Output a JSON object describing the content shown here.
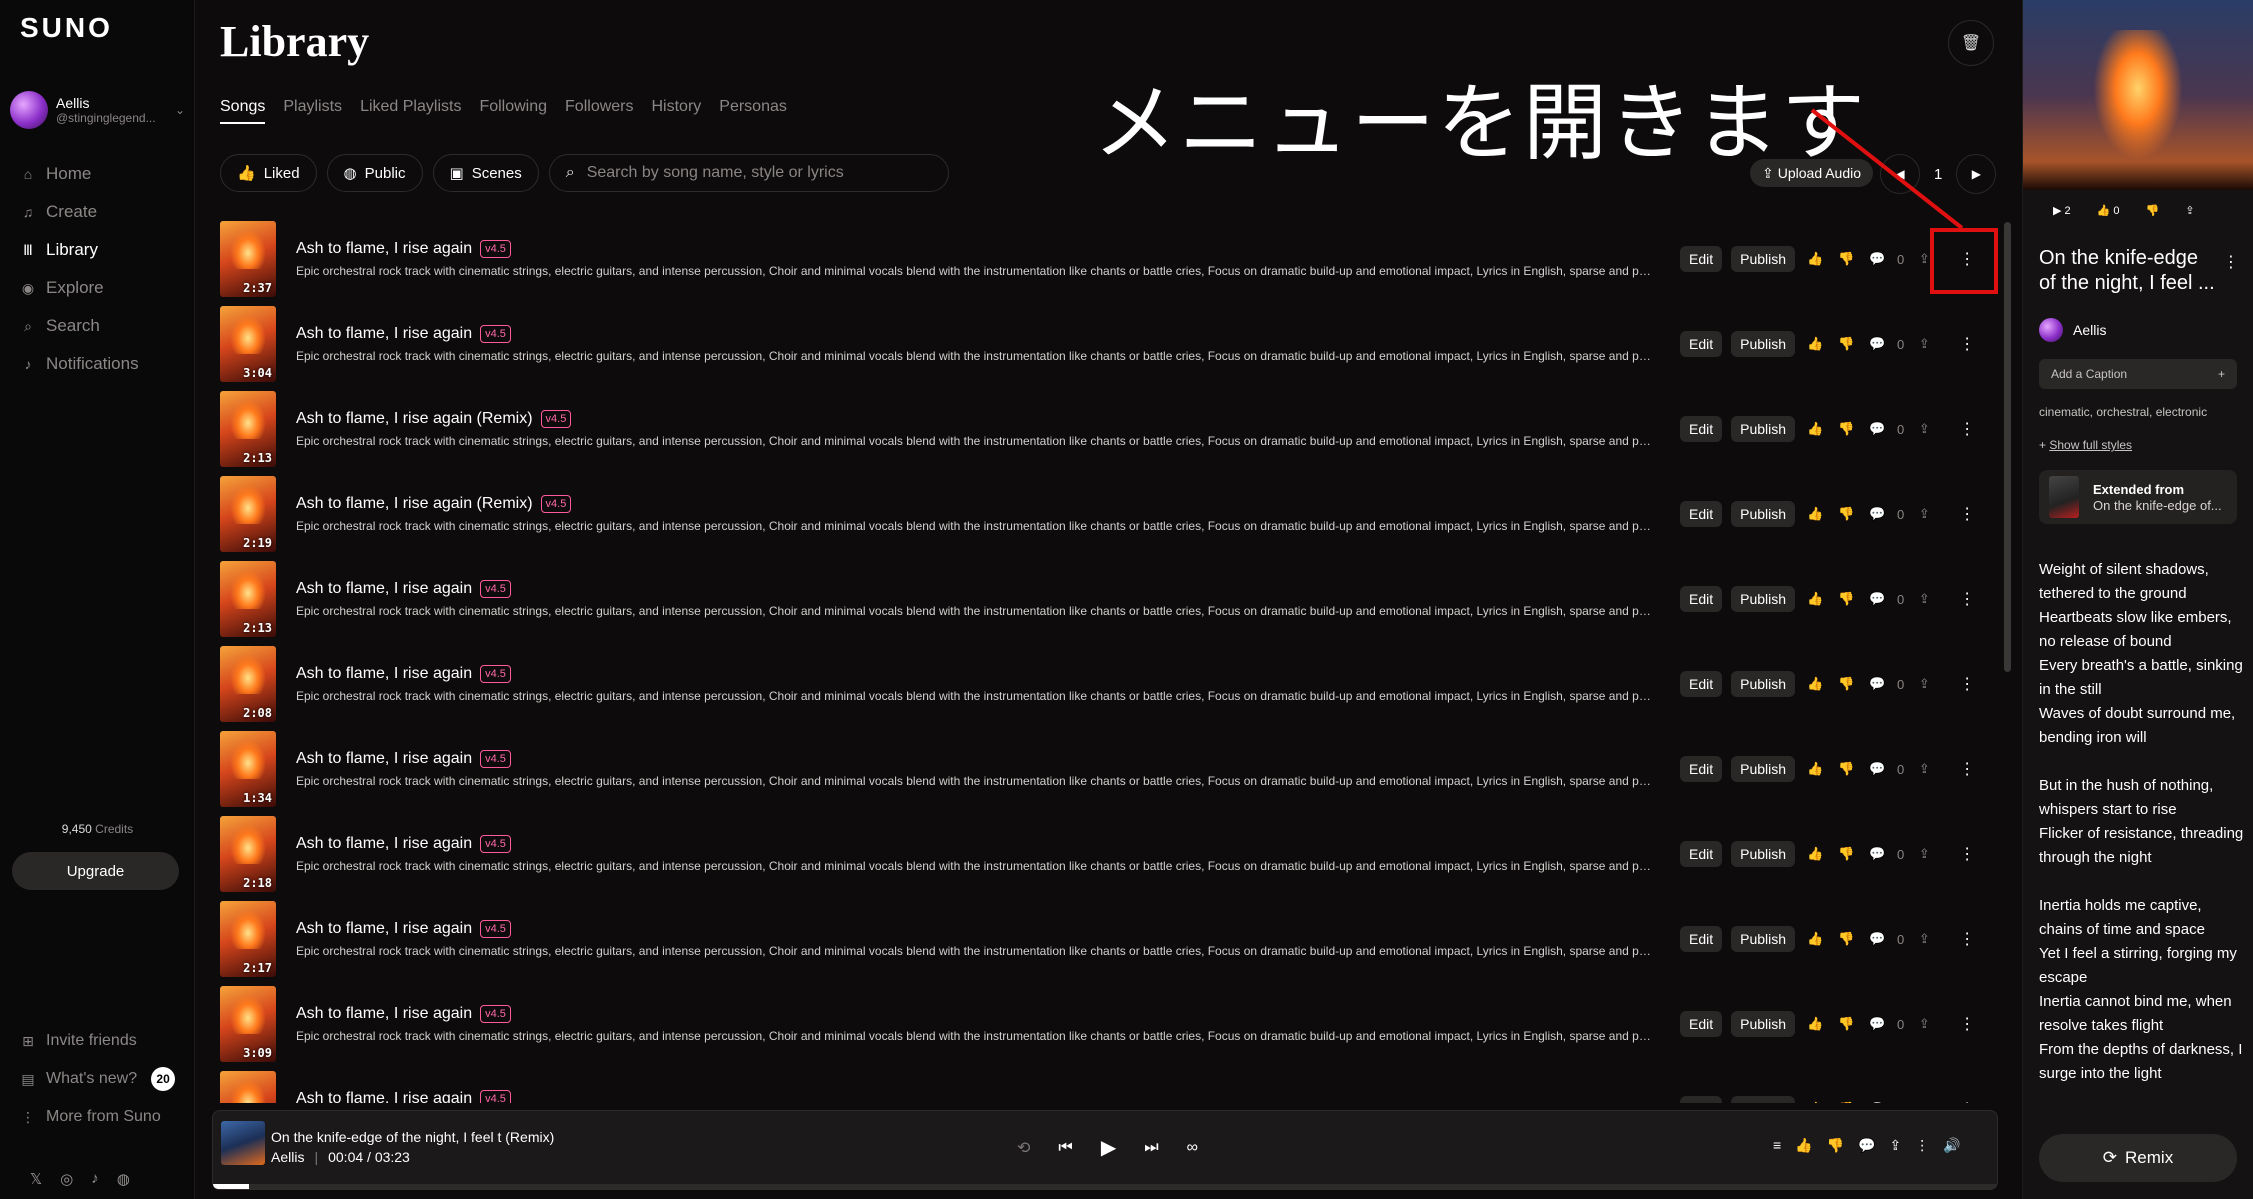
{
  "app": {
    "logo": "SUNO"
  },
  "profile": {
    "name": "Aellis",
    "handle": "@stinginglegend..."
  },
  "nav": [
    {
      "label": "Home",
      "icon": "home-icon"
    },
    {
      "label": "Create",
      "icon": "music-note-icon"
    },
    {
      "label": "Library",
      "icon": "library-icon"
    },
    {
      "label": "Explore",
      "icon": "compass-icon"
    },
    {
      "label": "Search",
      "icon": "search-icon"
    },
    {
      "label": "Notifications",
      "icon": "bell-icon"
    }
  ],
  "credits": {
    "amount": "9,450",
    "label": "Credits"
  },
  "upgrade_label": "Upgrade",
  "bottom_nav": {
    "invite": "Invite friends",
    "whats_new": "What's new?",
    "whats_new_count": "20",
    "more": "More from Suno"
  },
  "page": {
    "title": "Library"
  },
  "tabs": [
    "Songs",
    "Playlists",
    "Liked Playlists",
    "Following",
    "Followers",
    "History",
    "Personas"
  ],
  "filters": {
    "liked": "Liked",
    "public": "Public",
    "scenes": "Scenes",
    "search_placeholder": "Search by song name, style or lyrics"
  },
  "upload_label": "Upload Audio",
  "pager": {
    "page": "1"
  },
  "song_desc": "Epic orchestral rock track with cinematic strings, electric guitars, and intense percussion, Choir and minimal vocals blend with the instrumentation like chants or battle cries, Focus on dramatic build-up and emotional impact, Lyrics in English, sparse and poetic, about fire",
  "row_labels": {
    "edit": "Edit",
    "publish": "Publish",
    "comments": "0"
  },
  "songs": [
    {
      "title": "Ash to flame, I rise again",
      "version": "v4.5",
      "duration": "2:37"
    },
    {
      "title": "Ash to flame, I rise again",
      "version": "v4.5",
      "duration": "3:04"
    },
    {
      "title": "Ash to flame, I rise again (Remix)",
      "version": "v4.5",
      "duration": "2:13"
    },
    {
      "title": "Ash to flame, I rise again (Remix)",
      "version": "v4.5",
      "duration": "2:19"
    },
    {
      "title": "Ash to flame, I rise again",
      "version": "v4.5",
      "duration": "2:13"
    },
    {
      "title": "Ash to flame, I rise again",
      "version": "v4.5",
      "duration": "2:08"
    },
    {
      "title": "Ash to flame, I rise again",
      "version": "v4.5",
      "duration": "1:34"
    },
    {
      "title": "Ash to flame, I rise again",
      "version": "v4.5",
      "duration": "2:18"
    },
    {
      "title": "Ash to flame, I rise again",
      "version": "v4.5",
      "duration": "2:17"
    },
    {
      "title": "Ash to flame, I rise again",
      "version": "v4.5",
      "duration": "3:09"
    },
    {
      "title": "Ash to flame, I rise again",
      "version": "v4.5",
      "duration": ""
    }
  ],
  "player": {
    "title": "On the knife-edge of the night, I feel t (Remix)",
    "artist": "Aellis",
    "time": "00:04 / 03:23",
    "progress_fraction": 0.02
  },
  "right_panel": {
    "plays": "2",
    "likes": "0",
    "title": "On the knife-edge of the night, I feel ...",
    "artist": "Aellis",
    "caption_placeholder": "Add a Caption",
    "styles": "cinematic, orchestral, electronic",
    "show_styles_prefix": "+ ",
    "show_styles": "Show full styles",
    "extended_label": "Extended from",
    "extended_song": "On the knife-edge of...",
    "lyrics": [
      [
        "Weight of silent shadows, tethered to the ground",
        "Heartbeats slow like embers, no release of bound",
        "Every breath's a battle, sinking in the still",
        "Waves of doubt surround me, bending iron will"
      ],
      [
        "But in the hush of nothing, whispers start to rise",
        "Flicker of resistance, threading through the night"
      ],
      [
        "Inertia holds me captive, chains of time and space",
        "Yet I feel a stirring, forging my escape",
        "Inertia cannot bind me, when resolve takes flight",
        "From the depths of darkness, I surge into the light"
      ]
    ],
    "remix_label": "Remix"
  },
  "annotation": {
    "text": "メニューを開きます",
    "color": "#e01010"
  }
}
